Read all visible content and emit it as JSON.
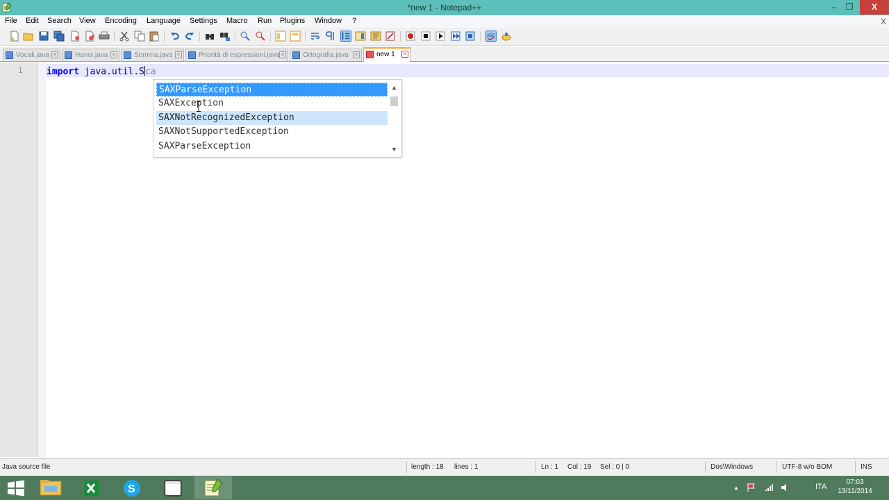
{
  "window": {
    "title": "*new  1 - Notepad++",
    "minimize_glyph": "–",
    "restore_glyph": "❐",
    "close_glyph": "X",
    "doc_close_glyph": "X"
  },
  "menu": {
    "items": [
      "File",
      "Edit",
      "Search",
      "View",
      "Encoding",
      "Language",
      "Settings",
      "Macro",
      "Run",
      "Plugins",
      "Window",
      "?"
    ]
  },
  "toolbar": {
    "icons": [
      "new-file-icon",
      "open-file-icon",
      "save-icon",
      "save-all-icon",
      "close-icon",
      "close-all-icon",
      "print-icon",
      "cut-icon",
      "copy-icon",
      "paste-icon",
      "undo-icon",
      "redo-icon",
      "find-icon",
      "replace-icon",
      "zoom-in-icon",
      "zoom-out-icon",
      "sync-vertical-icon",
      "sync-horizontal-icon",
      "word-wrap-icon",
      "show-all-chars-icon",
      "indent-guide-icon",
      "doc-map-icon",
      "function-list-icon",
      "folder-workspace-icon",
      "record-macro-icon",
      "stop-macro-icon",
      "play-macro-icon",
      "run-macro-multiple-icon",
      "save-macro-icon",
      "spell-check-icon",
      "plugin-icon"
    ]
  },
  "tabs": [
    {
      "label": "Vocali.java",
      "active": false
    },
    {
      "label": "Hanoi.java",
      "active": false
    },
    {
      "label": "Somma.java",
      "active": false
    },
    {
      "label": "Priorità di espressioni.java",
      "active": false
    },
    {
      "label": "Ortografia.java",
      "active": false
    },
    {
      "label": "new  1",
      "active": true
    }
  ],
  "editor": {
    "line_number": "1",
    "keyword": "import",
    "text": " java.util.S",
    "highlight_text": "ca"
  },
  "autocomplete": {
    "items": [
      "SAXParseException",
      "SAXException",
      "SAXNotRecognizedException",
      "SAXNotSupportedException",
      "SAXParseException"
    ],
    "selected_index": 0,
    "hover_index": 2,
    "scroll_up": "▲",
    "scroll_down": "▼"
  },
  "status": {
    "file_type": "Java source file",
    "length": "length : 18",
    "lines": "lines : 1",
    "ln": "Ln : 1",
    "col": "Col : 19",
    "sel": "Sel : 0 | 0",
    "eol": "Dos\\Windows",
    "encoding": "UTF-8 w/o BOM",
    "mode": "INS"
  },
  "taskbar": {
    "apps": [
      "file-explorer",
      "excel",
      "skype",
      "app-window",
      "notepad-plus-plus"
    ],
    "tray_language": "ITA",
    "tray_up_arrow": "▲",
    "time": "07:03",
    "date": "13/11/2014"
  },
  "colors": {
    "titlebar": "#5cbfb9",
    "selection": "#3399ff",
    "hover": "#cde6fd",
    "keyword": "#0000ff",
    "taskbar": "#4f7b5c"
  }
}
